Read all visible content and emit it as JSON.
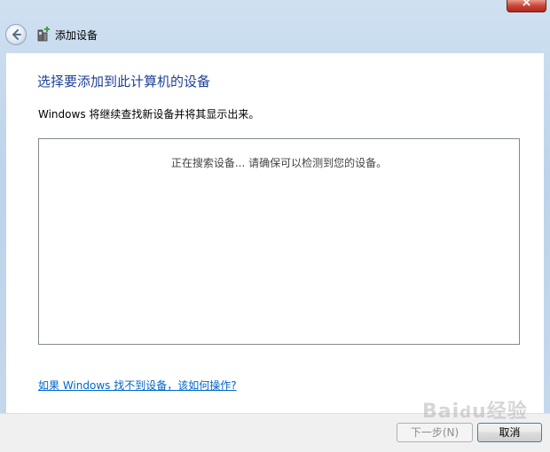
{
  "window": {
    "close_label": "×",
    "title": "添加设备",
    "back_icon": "back-arrow-icon",
    "header_icon": "add-device-icon"
  },
  "main": {
    "heading": "选择要添加到此计算机的设备",
    "description": "Windows 将继续查找新设备并将其显示出来。",
    "search_status": "正在搜索设备... 请确保可以检测到您的设备。",
    "help_link": "如果 Windows 找不到设备，该如何操作?"
  },
  "footer": {
    "next_label": "下一步(N)",
    "cancel_label": "取消"
  },
  "watermark": "Baidu经验",
  "colors": {
    "heading": "#1e3f96",
    "link": "#0066cc",
    "close": "#c9463a"
  }
}
